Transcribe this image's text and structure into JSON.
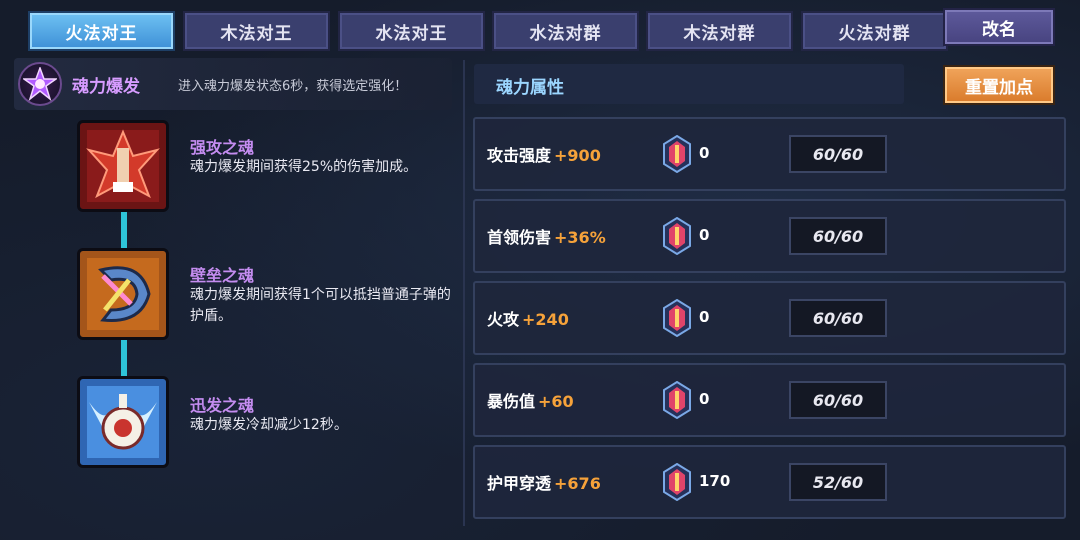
{
  "tabs": [
    {
      "label": "火法对王",
      "active": true
    },
    {
      "label": "木法对王",
      "active": false
    },
    {
      "label": "水法对王",
      "active": false
    },
    {
      "label": "水法对群",
      "active": false
    },
    {
      "label": "木法对群",
      "active": false
    },
    {
      "label": "火法对群",
      "active": false
    }
  ],
  "rename_label": "改名",
  "soul_burst": {
    "icon": "soul-burst-star-icon",
    "title": "魂力爆发",
    "description": "进入魂力爆发状态6秒，获得选定强化！"
  },
  "skills": [
    {
      "icon": "red-power-soul-icon",
      "name": "强攻之魂",
      "description": "魂力爆发期间获得25%的伤害加成。",
      "color": "#8a1b1b"
    },
    {
      "icon": "orange-barrier-soul-icon",
      "name": "壁垒之魂",
      "description": "魂力爆发期间获得1个可以抵挡普通子弹的护盾。",
      "color": "#c56a1e"
    },
    {
      "icon": "blue-swift-soul-icon",
      "name": "迅发之魂",
      "description": "魂力爆发冷却减少12秒。",
      "color": "#3d7fd0"
    }
  ],
  "attributes_title": "魂力属性",
  "reset_label": "重置加点",
  "attributes": [
    {
      "name": "攻击强度",
      "bonus": "+900",
      "gem_count": "0",
      "level": "60/60"
    },
    {
      "name": "首领伤害",
      "bonus": "+36%",
      "gem_count": "0",
      "level": "60/60"
    },
    {
      "name": "火攻",
      "bonus": "+240",
      "gem_count": "0",
      "level": "60/60"
    },
    {
      "name": "暴伤值",
      "bonus": "+60",
      "gem_count": "0",
      "level": "60/60"
    },
    {
      "name": "护甲穿透",
      "bonus": "+676",
      "gem_count": "170",
      "level": "52/60"
    }
  ],
  "colors": {
    "active_tab": "#4fa6e6",
    "inactive_tab": "#3a3f6e",
    "bonus": "#f6a23a",
    "skill_name": "#c48cf0",
    "reset_button": "#e08a3a"
  }
}
